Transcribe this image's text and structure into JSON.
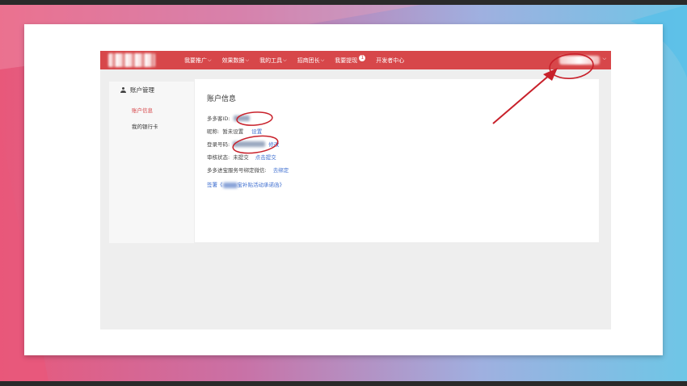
{
  "nav": {
    "items": [
      {
        "label": "我要推广",
        "dropdown": true
      },
      {
        "label": "效果数据",
        "dropdown": true
      },
      {
        "label": "我的工具",
        "dropdown": true
      },
      {
        "label": "招商团长",
        "dropdown": true
      },
      {
        "label": "我要提现",
        "dropdown": false,
        "badge": "1"
      },
      {
        "label": "开发者中心",
        "dropdown": false
      }
    ]
  },
  "sidebar": {
    "header": "账户管理",
    "items": [
      {
        "label": "账户信息",
        "active": true
      },
      {
        "label": "我的银行卡",
        "active": false
      }
    ]
  },
  "content": {
    "title": "账户信息",
    "id_label": "多多客ID:",
    "nickname_label": "昵称:",
    "nickname_value": "暂未设置",
    "nickname_action": "设置",
    "phone_label": "登录号码:",
    "phone_action": "修改",
    "review_label": "审核状态:",
    "review_value": "未提交",
    "review_action": "点击提交",
    "wechat_label": "多多进宝服务号绑定微信:",
    "wechat_action": "去绑定",
    "agreement_prefix": "签署《",
    "agreement_suffix": "宝补贴活动承诺函》"
  },
  "colors": {
    "brand_red": "#d7474a",
    "link_blue": "#3f6fd0",
    "annotation_red": "#c8202a"
  }
}
